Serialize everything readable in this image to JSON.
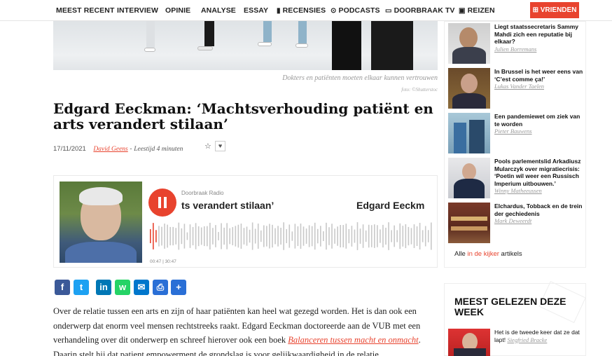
{
  "nav": {
    "items": [
      "MEEST RECENT",
      "INTERVIEW",
      "OPINIE",
      "ANALYSE",
      "ESSAY",
      "RECENSIES",
      "PODCASTS",
      "DOORBRAAK TV",
      "REIZEN"
    ],
    "vrienden": "VRIENDEN",
    "icons": [
      "book-icon",
      "play-circle-icon",
      "monitor-icon",
      "briefcase-icon",
      "gift-icon"
    ]
  },
  "hero": {
    "caption": "Dokters en patiënten moeten elkaar kunnen vertrouwen",
    "credit": "foto: ©Shutterstoc"
  },
  "article": {
    "title": "Edgard Eeckman: ‘Machtsverhouding patiënt en arts verandert stilaan’",
    "date": "17/11/2021",
    "author": "David Geens",
    "sep": " - ",
    "reading": "Leestijd 4 minuten"
  },
  "player": {
    "station": "Doorbraak Radio",
    "marquee_a": "ts verandert stilaan’",
    "marquee_b": "Edgard Eeckm",
    "time": "00:47 | 30:47",
    "progress": 0.025,
    "accent": "#e8432e"
  },
  "share": {
    "buttons": [
      {
        "name": "facebook",
        "glyph": "f",
        "color": "#3b5998"
      },
      {
        "name": "twitter",
        "glyph": "t",
        "color": "#1da1f2"
      },
      {
        "name": "linkedin",
        "glyph": "in",
        "color": "#0077b5"
      },
      {
        "name": "whatsapp",
        "glyph": "w",
        "color": "#25d366"
      },
      {
        "name": "email",
        "glyph": "✉",
        "color": "#0077cc"
      },
      {
        "name": "print",
        "glyph": "⎙",
        "color": "#2a6fd6"
      },
      {
        "name": "share",
        "glyph": "+",
        "color": "#2a6fd6"
      }
    ]
  },
  "body": {
    "p1": "Over de relatie tussen een arts en zijn of haar patiënten kan heel wat gezegd worden. Het is dan ook een onderwerp dat enorm veel mensen rechtstreeks raakt. Edgard Eeckman doctoreerde aan de VUB met een verhandeling over dit onderwerp en schreef hierover ook een boek ",
    "link": "Balanceren tussen macht en onmacht",
    "p2": ". Daarin stelt hij dat patient empowerment de grondslag is voor gelijkwaardigheid in de relatie"
  },
  "sidebar": {
    "items": [
      {
        "title": "Liegt staatssecretaris Sammy Mahdi zich een reputatie bij elkaar?",
        "author": "Julien Borremans"
      },
      {
        "title": "In Brussel is het weer eens van ‘C’est comme ça!’",
        "author": "Lukas Vander Taelen"
      },
      {
        "title": "Een pandemiewet om ziek van te worden",
        "author": "Pieter Bauwens"
      },
      {
        "title": "Pools parlementslid Arkadiusz Mularczyk over migratiecrisis: ‘Poetin wil weer een Russisch Imperium uitbouwen.’",
        "author": "Winny Matheeussen"
      },
      {
        "title": "Elchardus, Tobback en de trein der gechiedenis",
        "author": "Mark Deweerdt"
      }
    ],
    "alle_pre": "Alle ",
    "alle_link": "in de kijker",
    "alle_post": " artikels"
  },
  "mostread": {
    "title": "MEEST GELEZEN DEZE WEEK",
    "item_text": "Het is de tweede keer dat ze dat lapt! ",
    "item_author": "Siegfried Bracke"
  }
}
